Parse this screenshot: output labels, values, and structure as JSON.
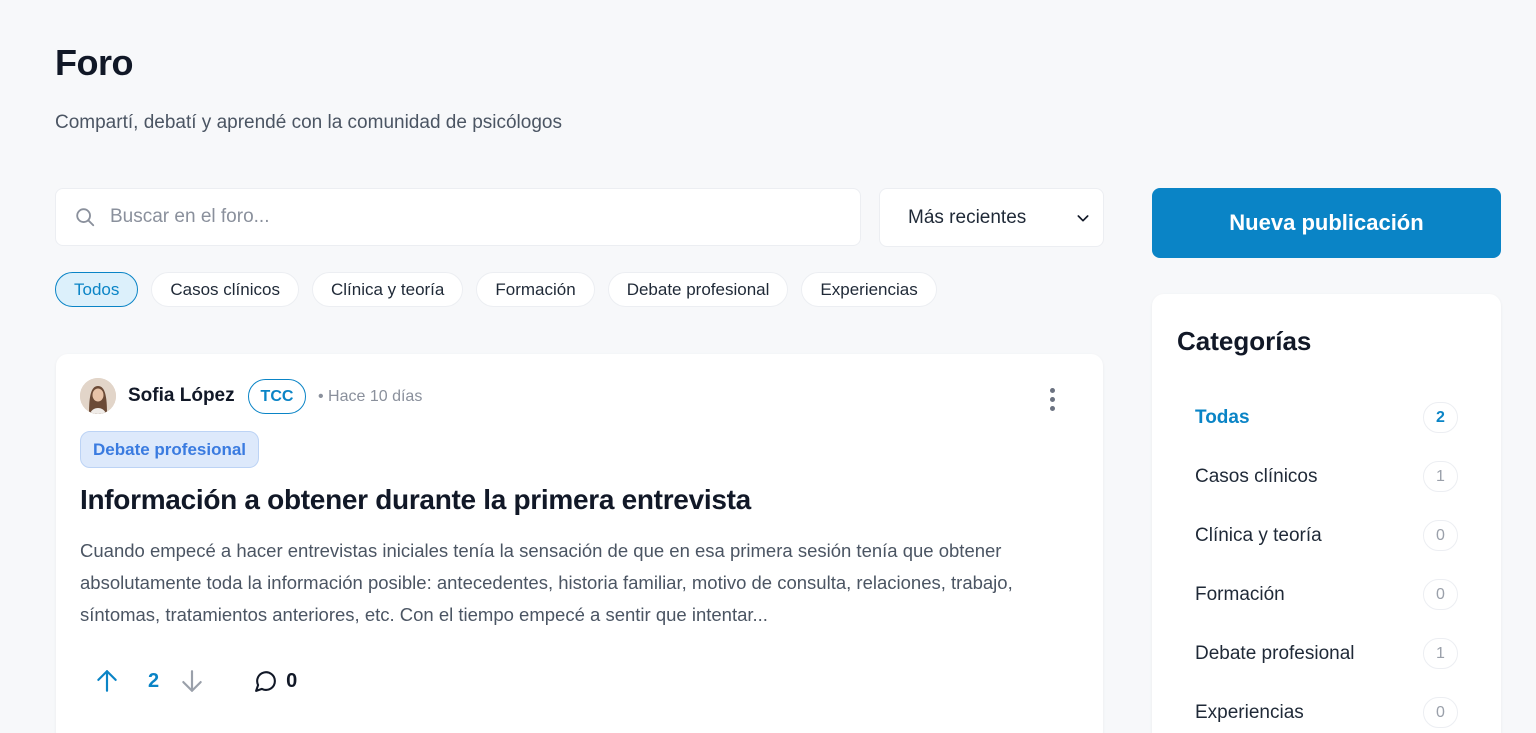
{
  "header": {
    "title": "Foro",
    "subtitle": "Compartí, debatí y aprendé con la comunidad de psicólogos"
  },
  "search": {
    "placeholder": "Buscar en el foro...",
    "value": ""
  },
  "sort": {
    "selected": "Más recientes"
  },
  "new_post_label": "Nueva publicación",
  "filters": [
    {
      "label": "Todos",
      "active": true
    },
    {
      "label": "Casos clínicos",
      "active": false
    },
    {
      "label": "Clínica y teoría",
      "active": false
    },
    {
      "label": "Formación",
      "active": false
    },
    {
      "label": "Debate profesional",
      "active": false
    },
    {
      "label": "Experiencias",
      "active": false
    }
  ],
  "post": {
    "author": "Sofia López",
    "author_tag": "TCC",
    "time": "• Hace 10 días",
    "category": "Debate profesional",
    "title": "Información a obtener durante la primera entrevista",
    "excerpt": "Cuando empecé a hacer entrevistas iniciales tenía la sensación de que en esa primera sesión tenía que obtener absolutamente toda la información posible: antecedentes, historia familiar, motivo de consulta, relaciones, trabajo, síntomas, tratamientos anteriores, etc. Con el tiempo empecé a sentir que intentar...",
    "votes": "2",
    "comments": "0"
  },
  "categories_panel": {
    "title": "Categorías",
    "items": [
      {
        "label": "Todas",
        "count": "2",
        "active": true
      },
      {
        "label": "Casos clínicos",
        "count": "1",
        "active": false
      },
      {
        "label": "Clínica y teoría",
        "count": "0",
        "active": false
      },
      {
        "label": "Formación",
        "count": "0",
        "active": false
      },
      {
        "label": "Debate profesional",
        "count": "1",
        "active": false
      },
      {
        "label": "Experiencias",
        "count": "0",
        "active": false
      }
    ]
  },
  "colors": {
    "accent": "#0a84c6",
    "background": "#f7f8fa",
    "badge_bg": "#dde9fb",
    "badge_text": "#3a7be0"
  }
}
